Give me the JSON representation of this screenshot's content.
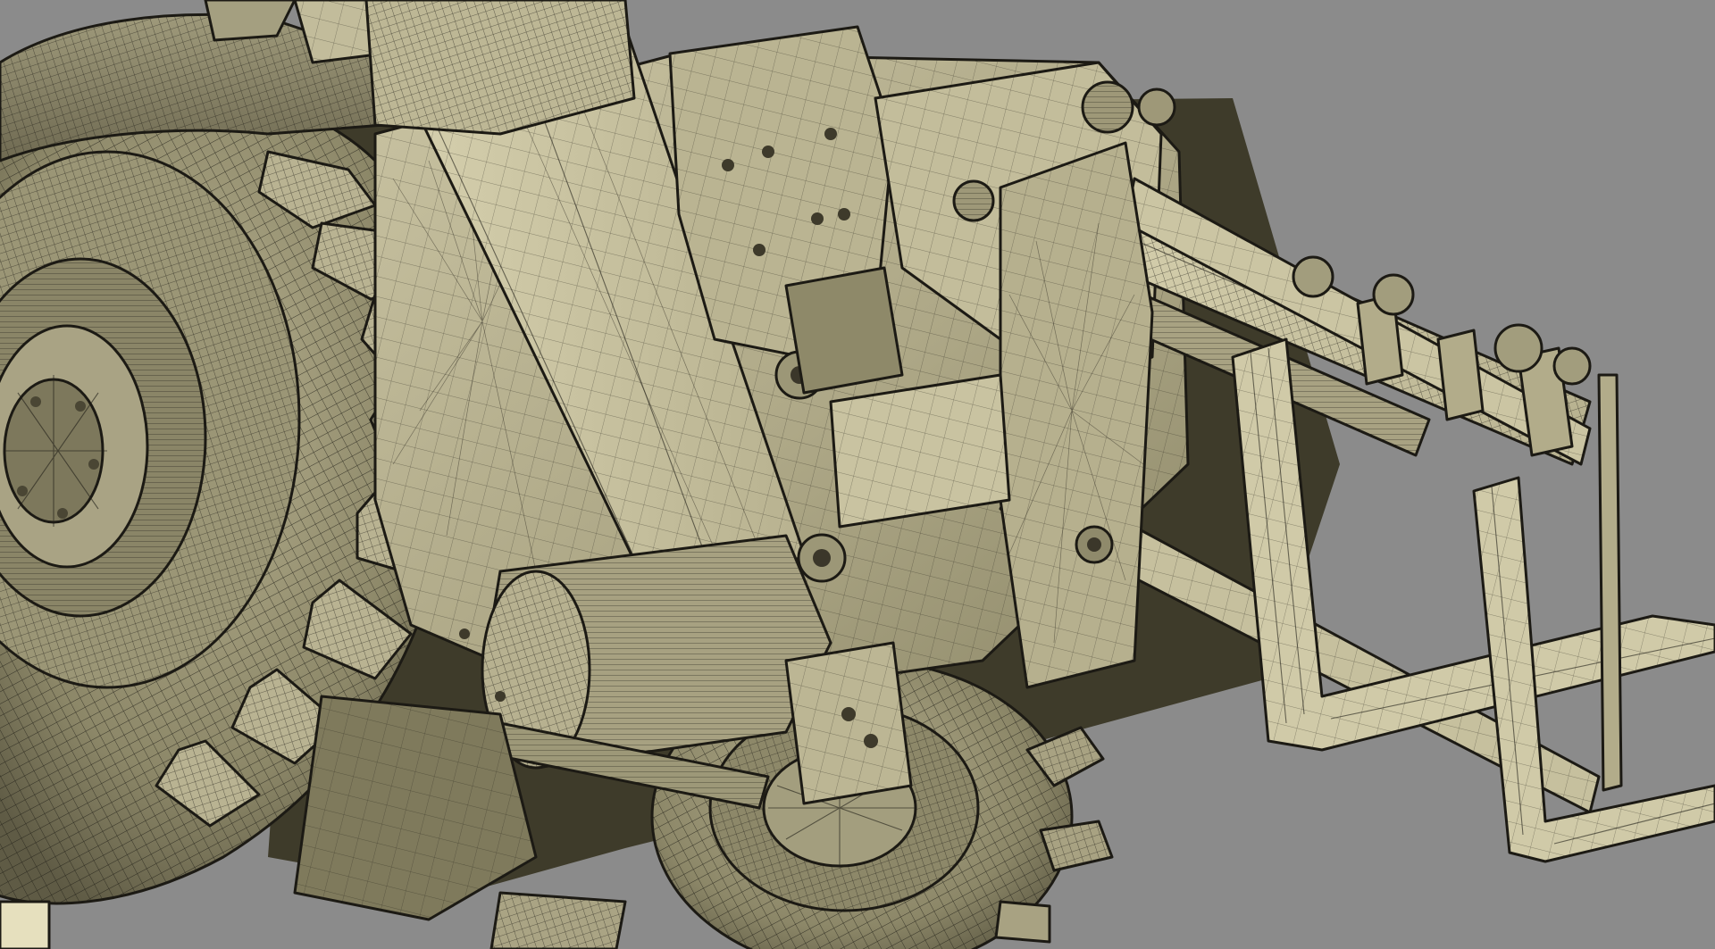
{
  "viewport": {
    "kind": "3d-wireframe-render",
    "subject": "telehandler-front-axle-boom-and-fork-carriage",
    "background_color": "#8b8b8b",
    "surface_color": "#b3ad8c",
    "surface_shadow_color": "#7f7a5f",
    "edge_color": "#1c1a14"
  }
}
